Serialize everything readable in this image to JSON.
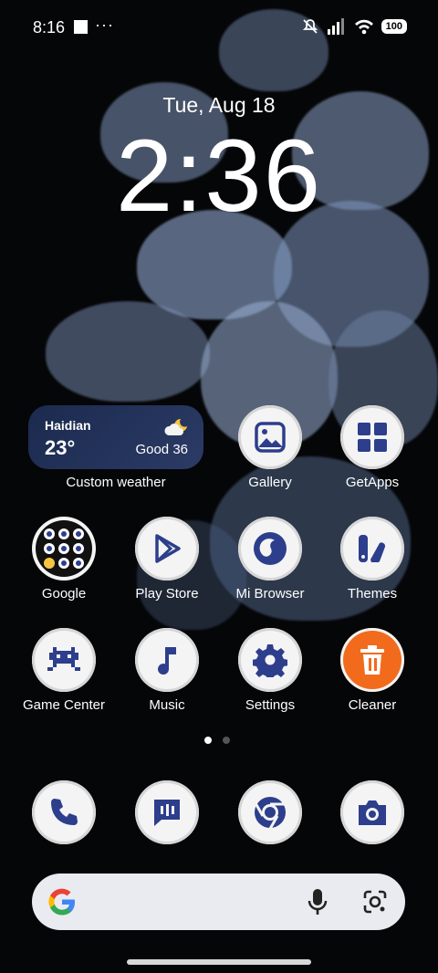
{
  "status_bar": {
    "time": "8:16",
    "more": "···",
    "battery": "100"
  },
  "lock": {
    "date": "Tue, Aug 18",
    "clock": "2:36"
  },
  "weather_widget": {
    "city": "Haidian",
    "temperature": "23°",
    "air_quality": "Good 36",
    "label": "Custom weather",
    "icon": "partly-cloudy-night-icon"
  },
  "apps": {
    "gallery": "Gallery",
    "getapps": "GetApps",
    "google": "Google",
    "play_store": "Play Store",
    "mi_browser": "Mi Browser",
    "themes": "Themes",
    "game_center": "Game Center",
    "music": "Music",
    "settings": "Settings",
    "cleaner": "Cleaner"
  },
  "dock": [
    "phone-icon",
    "messages-icon",
    "chrome-icon",
    "camera-icon"
  ],
  "pager": {
    "pages": 2,
    "current": 1
  },
  "colors": {
    "icon_blue": "#2d3e8c",
    "cleaner_orange": "#f26b1d",
    "icon_bg": "#f4f4f4"
  }
}
